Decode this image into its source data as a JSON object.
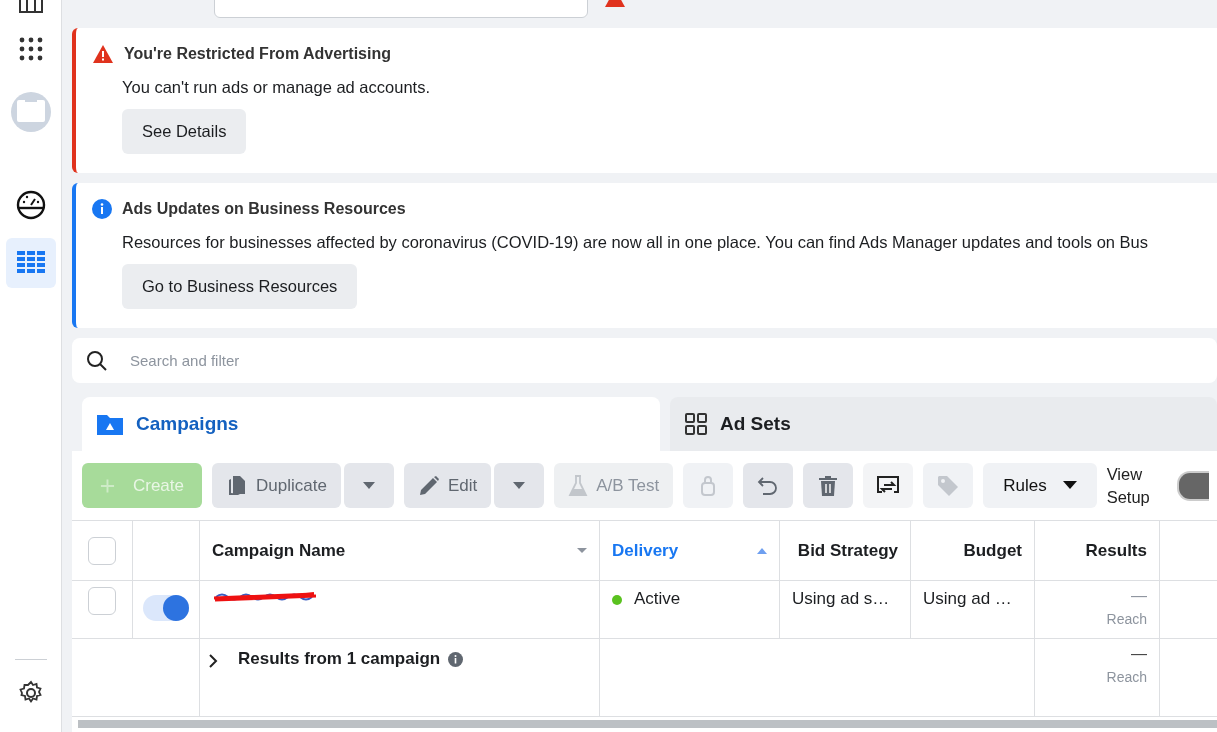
{
  "top_bar": {
    "errors_flag": true
  },
  "sidebar": {
    "items": [
      {
        "kind": "columns",
        "selected": false
      },
      {
        "kind": "apps",
        "selected": false
      },
      {
        "kind": "account",
        "selected": false
      },
      {
        "kind": "gauge",
        "selected": false
      },
      {
        "kind": "table",
        "selected": true
      }
    ],
    "bottom": [
      {
        "kind": "settings"
      }
    ]
  },
  "banners": [
    {
      "kind": "error",
      "title": "You're Restricted From Advertising",
      "text": "You can't run ads or manage ad accounts.",
      "button": "See Details"
    },
    {
      "kind": "info",
      "title": "Ads Updates on Business Resources",
      "text": "Resources for businesses affected by coronavirus (COVID-19) are now all in one place. You can find Ads Manager updates and tools on Bus",
      "button": "Go to Business Resources"
    }
  ],
  "search": {
    "placeholder": "Search and filter"
  },
  "tabs": [
    {
      "label": "Campaigns",
      "kind": "folder",
      "selected": true
    },
    {
      "label": "Ad Sets",
      "kind": "grid",
      "selected": false
    }
  ],
  "toolbar": [
    {
      "kind": "create",
      "label": "Create",
      "disabled": true
    },
    {
      "kind": "duplicate",
      "label": "Duplicate",
      "disabled": false
    },
    {
      "kind": "edit",
      "label": "Edit",
      "disabled": false
    },
    {
      "kind": "abtest",
      "label": "A/B Test",
      "disabled": true
    },
    {
      "kind": "lock",
      "disabled": true
    },
    {
      "kind": "undo",
      "disabled": false
    },
    {
      "kind": "delete",
      "disabled": false
    },
    {
      "kind": "export",
      "disabled": false
    },
    {
      "kind": "tag",
      "disabled": true
    },
    {
      "kind": "rules",
      "label": "Rules",
      "disabled": false
    }
  ],
  "view_setup": {
    "label": "View Setup",
    "on": false
  },
  "table": {
    "select_all": {
      "checked": false
    },
    "columns": [
      {
        "label": "Campaign Name",
        "active": false
      },
      {
        "label": "Delivery",
        "active": true
      },
      {
        "label": "Bid Strategy",
        "active": false
      },
      {
        "label": "Budget",
        "active": false
      },
      {
        "label": "Results",
        "active": false
      }
    ],
    "rows": [
      {
        "checked": false,
        "on": true,
        "name_redacted": true,
        "delivery": "Active",
        "color": "#5ac21f",
        "bid_strategy": "Using ad s…",
        "budget": "Using ad …",
        "results": "—",
        "results_label": "Reach"
      }
    ],
    "summary": {
      "label": "Results from 1 campaign",
      "expanded": false,
      "results": "—",
      "results_label": "Reach"
    }
  }
}
